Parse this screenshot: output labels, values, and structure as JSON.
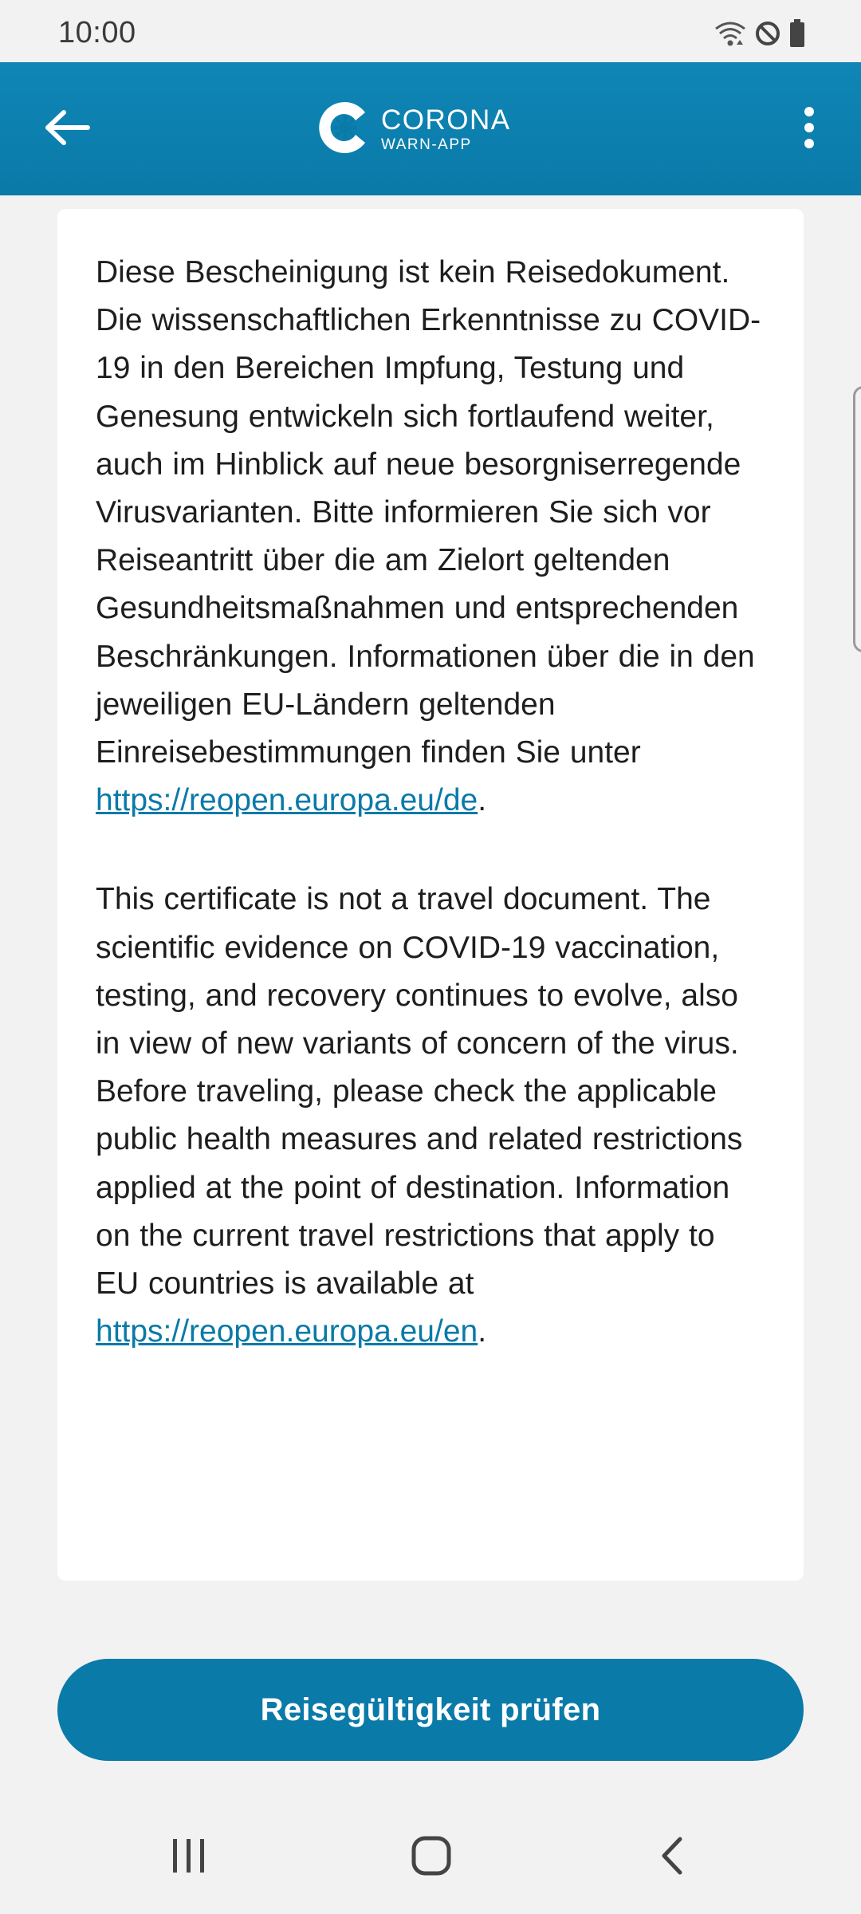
{
  "status_bar": {
    "time": "10:00",
    "icons": [
      "wifi-icon",
      "do-not-disturb-icon",
      "battery-icon"
    ]
  },
  "app_bar": {
    "back_icon": "arrow-left-icon",
    "logo_title": "CORONA",
    "logo_subtitle": "WARN-APP",
    "overflow_icon": "more-vert-icon",
    "background_color": "#0a7aa8"
  },
  "content": {
    "paragraph_de": {
      "text": "Diese Bescheinigung ist kein Reisedokument. Die wissenschaftlichen Erkenntnisse zu COVID-19 in den Bereichen Impfung, Testung und Genesung entwickeln sich fortlaufend weiter, auch im Hinblick auf neue besorgniserregende Virusvarianten. Bitte informieren Sie sich vor Reiseantritt über die am Zielort geltenden Gesundheitsmaßnahmen und entsprechenden Beschränkungen. Informationen über die in den jeweiligen EU-Ländern geltenden Einreisebestimmungen finden Sie unter ",
      "link": "https://reopen.europa.eu/de",
      "suffix": "."
    },
    "paragraph_en": {
      "text": "This certificate is not a travel document. The scientific evidence on COVID-19 vaccination, testing, and recovery continues to evolve, also in view of new variants of concern of the virus. Before traveling, please check the applicable public health measures and related restrictions applied at the point of destination. Information on the current travel restrictions that apply to EU countries is available at ",
      "link": "https://reopen.europa.eu/en",
      "suffix": "."
    }
  },
  "primary_button": {
    "label": "Reisegültigkeit prüfen"
  },
  "nav_bar": {
    "icons": [
      "recent-apps-icon",
      "home-icon",
      "back-icon"
    ]
  },
  "colors": {
    "accent": "#0a7aa8",
    "background": "#f2f2f2",
    "card": "#ffffff",
    "text": "#1e1e1e"
  }
}
